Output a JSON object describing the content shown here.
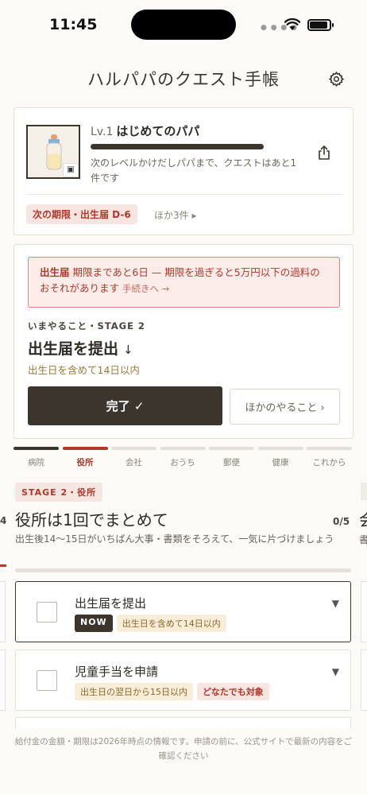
{
  "status": {
    "time": "11:45"
  },
  "header": {
    "title": "ハルパパのクエスト手帳"
  },
  "profile": {
    "level_prefix": "Lv.1",
    "level_name": "はじめてのパパ",
    "xp_progress": 1.0,
    "next_level_text": "次のレベルかけだしパパまで、クエストはあと1件です",
    "deadline_badge": "次の期限・出生届 D-6",
    "deadline_more": "ほか3件 ▸"
  },
  "alert": {
    "strong": "出生届",
    "text": " 期限まであと6日 — 期限を過ぎると5万円以下の過料のおそれがあります",
    "link": "手続きへ →"
  },
  "current_task": {
    "stage_line": "いまやること・STAGE 2",
    "title": "出生届を提出",
    "arrow": "↓",
    "subtitle": "出生日を含めて14日以内",
    "done_label": "完了 ✓",
    "other_label": "ほかのやること ›"
  },
  "stage_tabs": [
    {
      "label": "病院",
      "state": "done"
    },
    {
      "label": "役所",
      "state": "current"
    },
    {
      "label": "会社",
      "state": "upcoming"
    },
    {
      "label": "おうち",
      "state": "upcoming"
    },
    {
      "label": "郵便",
      "state": "upcoming"
    },
    {
      "label": "健康",
      "state": "upcoming"
    },
    {
      "label": "これから",
      "state": "upcoming"
    }
  ],
  "stage": {
    "chip": "STAGE 2・役所",
    "heading": "役所は1回でまとめて",
    "count": "0/5",
    "description": "出生後14〜15日がいちばん大事・書類をそろえて、一気に片づけましょう",
    "progress": 0,
    "prev_count_edge": "4",
    "next_heading_edge": "会",
    "next_desc_edge": "書"
  },
  "checklist": [
    {
      "name": "出生届を提出",
      "active": true,
      "tags": [
        {
          "text": "NOW",
          "style": "now"
        },
        {
          "text": "出生日を含めて14日以内",
          "style": "gold"
        }
      ]
    },
    {
      "name": "児童手当を申請",
      "active": false,
      "tags": [
        {
          "text": "出生日の翌日から15日以内",
          "style": "gold"
        },
        {
          "text": "どなたでも対象",
          "style": "red"
        }
      ]
    }
  ],
  "footer": {
    "note": "給付金の金額・期限は2026年時点の情報です。申請の前に、公式サイトで最新の内容をご確認ください"
  },
  "colors": {
    "accent_red": "#b0382a",
    "dark": "#3b352e",
    "gold": "#9a7b3a",
    "background": "#fbfaf7"
  }
}
